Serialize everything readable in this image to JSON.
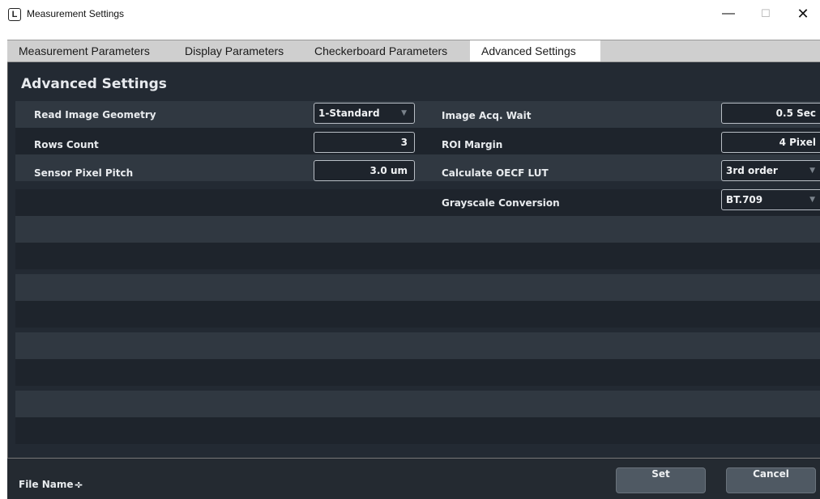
{
  "window": {
    "icon_glyph": "L",
    "title": "Measurement Settings",
    "controls": {
      "minimize": "—",
      "maximize": "☐",
      "close": "✕"
    }
  },
  "tabs": [
    {
      "label": "Measurement Parameters",
      "active": false
    },
    {
      "label": "Display Parameters",
      "active": false
    },
    {
      "label": "Checkerboard Parameters",
      "active": false
    },
    {
      "label": "Advanced Settings",
      "active": true
    }
  ],
  "panel": {
    "title": "Advanced Settings",
    "left": [
      {
        "label": "Read Image Geometry",
        "value": "1-Standard",
        "type": "dropdown"
      },
      {
        "label": "Rows Count",
        "value": "3",
        "type": "number"
      },
      {
        "label": "Sensor Pixel Pitch",
        "value": "3.0 um",
        "type": "number"
      }
    ],
    "right": [
      {
        "label": "Image Acq. Wait",
        "value": "0.5 Sec",
        "type": "number"
      },
      {
        "label": "ROI Margin",
        "value": "4 Pixel",
        "type": "number"
      },
      {
        "label": "Calculate OECF LUT",
        "value": "3rd order",
        "type": "dropdown"
      },
      {
        "label": "Grayscale Conversion",
        "value": "BT.709",
        "type": "dropdown"
      }
    ]
  },
  "footer": {
    "file_label": "File Name :",
    "file_value": "--",
    "set_label": "Set",
    "cancel_label": "Cancel"
  },
  "colors": {
    "panel_bg": "#232a33",
    "row_light": "#303841",
    "row_dark": "#1e242c",
    "tab_bar": "#cfcfcf",
    "button": "#4f5963"
  },
  "icons": {
    "dropdown": "caret-down-icon",
    "app": "app-logo-icon"
  }
}
